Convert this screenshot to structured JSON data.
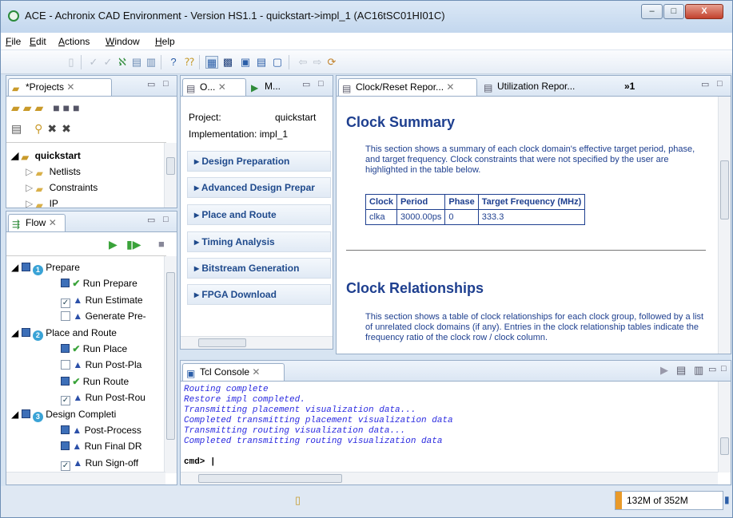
{
  "window": {
    "title": "ACE - Achronix CAD Environment - Version HS1.1 - quickstart->impl_1 (AC16tSC01HI01C)",
    "minimize": "–",
    "maximize": "□",
    "close": "X"
  },
  "menu": [
    {
      "key": "F",
      "rest": "ile"
    },
    {
      "key": "E",
      "rest": "dit"
    },
    {
      "key": "A",
      "rest": "ctions"
    },
    {
      "key": "W",
      "rest": "indow"
    },
    {
      "key": "H",
      "rest": "elp"
    }
  ],
  "projects": {
    "tab_label": "*Projects",
    "tree": {
      "root": "quickstart",
      "children": [
        "Netlists",
        "Constraints",
        "IP"
      ]
    }
  },
  "flow": {
    "tab_label": "Flow",
    "groups": [
      {
        "num": "1",
        "label": "Prepare",
        "items": [
          {
            "label": "Run Prepare",
            "status": "done",
            "checked": "filled"
          },
          {
            "label": "Run Estimate",
            "status": "pending",
            "checked": "check"
          },
          {
            "label": "Generate Pre-",
            "status": "pending",
            "checked": "empty"
          }
        ]
      },
      {
        "num": "2",
        "label": "Place and Route",
        "items": [
          {
            "label": "Run Place",
            "status": "done",
            "checked": "filled"
          },
          {
            "label": "Run Post-Pla",
            "status": "pending",
            "checked": "empty"
          },
          {
            "label": "Run Route",
            "status": "done",
            "checked": "filled"
          },
          {
            "label": "Run Post-Rou",
            "status": "pending",
            "checked": "check"
          }
        ]
      },
      {
        "num": "3",
        "label": "Design Completi",
        "items": [
          {
            "label": "Post-Process",
            "status": "pending",
            "checked": "filled"
          },
          {
            "label": "Run Final DR",
            "status": "pending",
            "checked": "filled"
          },
          {
            "label": "Run Sign-off",
            "status": "pending",
            "checked": "check"
          }
        ]
      }
    ]
  },
  "options": {
    "tab1": "O...",
    "tab2": "M...",
    "project_label": "Project:",
    "project_value": "quickstart",
    "impl_label": "Implementation:",
    "impl_value": "impl_1",
    "sections": [
      "Design Preparation",
      "Advanced Design Prepar",
      "Place and Route",
      "Timing Analysis",
      "Bitstream Generation",
      "FPGA Download"
    ]
  },
  "reports": {
    "tab1": "Clock/Reset Repor...",
    "tab2": "Utilization Repor...",
    "overflow": "»1",
    "summary_title": "Clock Summary",
    "summary_text": "This section shows a summary of each clock domain's effective target period, phase, and target frequency. Clock constraints that were not specified by the user are highlighted in the table below.",
    "table_headers": [
      "Clock",
      "Period",
      "Phase",
      "Target Frequency (MHz)"
    ],
    "table_rows": [
      [
        "clka",
        "3000.00ps",
        "0",
        "333.3"
      ]
    ],
    "relationships_title": "Clock Relationships",
    "relationships_text": "This section shows a table of clock relationships for each clock group, followed by a list of unrelated clock domains (if any). Entries in the clock relationship tables indicate the frequency ratio of the clock row / clock column."
  },
  "console": {
    "tab_label": "Tcl Console",
    "lines": [
      "Routing complete",
      "Restore impl completed.",
      "Transmitting placement visualization data...",
      "Completed transmitting placement visualization data",
      "Transmitting routing visualization data...",
      "Completed transmitting routing visualization data"
    ],
    "prompt": "cmd> |"
  },
  "status": {
    "memory": "132M of 352M"
  },
  "colors": {
    "accent": "#1e3f8f",
    "console_text": "#2a2ae0",
    "done_check": "#3aa33a"
  }
}
